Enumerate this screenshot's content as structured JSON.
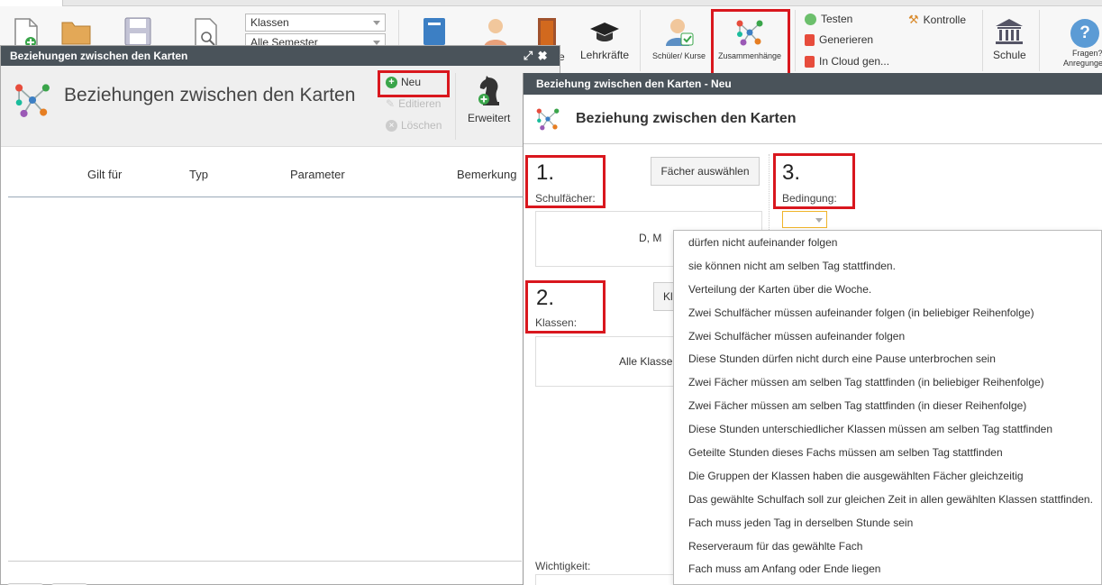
{
  "ribbon": {
    "selects": [
      {
        "value": "Klassen"
      },
      {
        "value": "Alle Semester"
      }
    ],
    "buttons": {
      "lehrkraefte": "Lehrkräfte",
      "schueler_kurse": "Schüler/ Kurse",
      "zusammenhaenge": "Zusammenhänge",
      "schule": "Schule",
      "fragen": "Fragen?",
      "anregungen": "Anregunge",
      "partial_e": "e"
    },
    "actions": {
      "testen": "Testen",
      "generieren": "Generieren",
      "cloud": "In Cloud gen...",
      "kontrolle": "Kontrolle"
    }
  },
  "left_window": {
    "title": "Beziehungen zwischen den Karten",
    "heading": "Beziehungen zwischen den Karten",
    "actions": {
      "neu": "Neu",
      "editieren": "Editieren",
      "loeschen": "Löschen",
      "erweitert": "Erweitert"
    },
    "columns": [
      "Gilt für",
      "Typ",
      "Parameter",
      "Bemerkung"
    ]
  },
  "right_window": {
    "title": "Beziehung zwischen den Karten - Neu",
    "heading": "Beziehung zwischen den Karten",
    "step1": {
      "number": "1.",
      "label": "Schulfächer:",
      "button": "Fächer auswählen",
      "value": "D, M"
    },
    "step2": {
      "number": "2.",
      "label": "Klassen:",
      "button": "Kl",
      "value": "Alle Klasse"
    },
    "step3": {
      "number": "3.",
      "label": "Bedingung:"
    },
    "wichtigkeit_label": "Wichtigkeit:"
  },
  "condition_options": [
    "dürfen nicht aufeinander folgen",
    "sie können nicht am selben Tag stattfinden.",
    "Verteilung der Karten über die Woche.",
    "Zwei Schulfächer müssen aufeinander folgen (in beliebiger Reihenfolge)",
    "Zwei Schulfächer müssen aufeinander folgen",
    "Diese Stunden dürfen nicht durch eine Pause unterbrochen sein",
    "Zwei Fächer müssen am selben Tag stattfinden (in beliebiger Reihenfolge)",
    "Zwei Fächer müssen am selben Tag stattfinden (in dieser Reihenfolge)",
    "Diese Stunden unterschiedlicher Klassen müssen am selben Tag stattfinden",
    "Geteilte Stunden dieses Fachs müssen am selben Tag stattfinden",
    "Die Gruppen der Klassen haben die ausgewählten Fächer gleichzeitig",
    "Das gewählte Schulfach soll zur gleichen Zeit in allen gewählten Klassen stattfinden.",
    "Fach muss jeden Tag in derselben Stunde sein",
    "Reserveraum für das gewählte Fach",
    "Fach muss am Anfang oder Ende liegen"
  ],
  "colors": {
    "highlight": "#d9171e",
    "titlebar": "#4a535a",
    "green": "#3aa54a"
  }
}
